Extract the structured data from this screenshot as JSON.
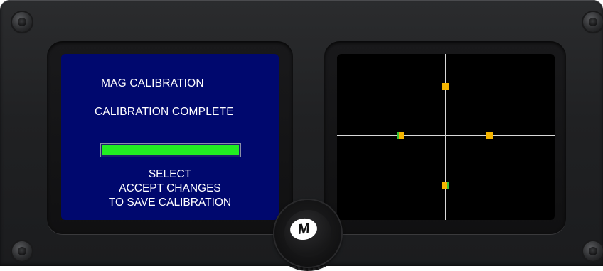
{
  "left_display": {
    "title": "MAG CALIBRATION",
    "status": "CALIBRATION COMPLETE",
    "progress_fraction": 1.0,
    "instructions": [
      "SELECT",
      "ACCEPT CHANGES",
      "TO SAVE CALIBRATION"
    ]
  },
  "right_display": {
    "markers": [
      "top",
      "left",
      "right",
      "bottom"
    ]
  },
  "knob": {
    "logo_text": "M"
  },
  "colors": {
    "left_screen_bg": "#00086e",
    "progress_fill": "#22ee22",
    "marker": "#f4b400",
    "marker_accent": "#38c238"
  },
  "icons": [
    "screw-icon",
    "knob-logo-icon"
  ]
}
